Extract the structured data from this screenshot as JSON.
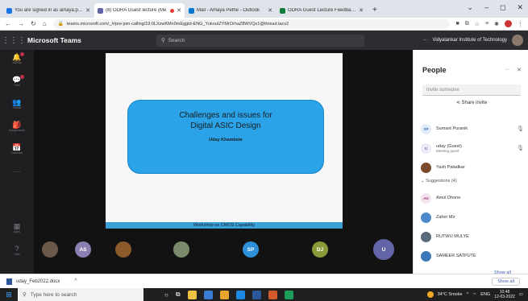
{
  "browser": {
    "tabs": [
      {
        "title": "You are signed in as amaya.pethe",
        "favicon_color": "#1a73e8",
        "active": false,
        "recording": false
      },
      {
        "title": "(8) ODRA Guest lecture (Me",
        "favicon_color": "#6264a7",
        "active": true,
        "recording": true
      },
      {
        "title": "Mail - Amaya Pethe - Outlook",
        "favicon_color": "#0078d4",
        "active": false,
        "recording": false
      },
      {
        "title": "ODRA Guest Lecture Feedback i",
        "favicon_color": "#0f7b3b",
        "active": false,
        "recording": false
      }
    ],
    "new_tab": "+",
    "window_controls": [
      "⌄",
      "–",
      "◻",
      "✕"
    ],
    "url": "teams.microsoft.com/_#/pre-join-calling/19:0LXzwKMn9mEggtd-ENG_YukouIZYMrOrhaZ8WVQs1@thread.tacv2"
  },
  "teams": {
    "brand": "Microsoft Teams",
    "search_placeholder": "Search",
    "org_name": "Vidyalankar Institute of Technology",
    "more_glyph": "···"
  },
  "rail": [
    {
      "icon": "bell-icon",
      "glyph": "🔔",
      "label": "Activity",
      "badge": true
    },
    {
      "icon": "chat-icon",
      "glyph": "💬",
      "label": "Chat",
      "badge": true
    },
    {
      "icon": "teams-icon",
      "glyph": "👥",
      "label": "Teams",
      "badge": false
    },
    {
      "icon": "assignments-icon",
      "glyph": "🎒",
      "label": "Assignments",
      "badge": false
    },
    {
      "icon": "calendar-icon",
      "glyph": "📅",
      "label": "Calendar",
      "badge": false
    },
    {
      "icon": "more-icon",
      "glyph": "···",
      "label": "",
      "badge": false
    },
    {
      "icon": "apps-icon",
      "glyph": "▦",
      "label": "Apps",
      "badge": false
    },
    {
      "icon": "help-icon",
      "glyph": "?",
      "label": "Help",
      "badge": false
    }
  ],
  "slide": {
    "title_line1": "Challenges  and issues for",
    "title_line2": "Digital ASIC Design",
    "author": "Uday Khambete",
    "caption": "Workshop on CMOS Capability",
    "box_color": "#2aa3e8"
  },
  "participants_strip": [
    {
      "initials": "",
      "kind": "photo1"
    },
    {
      "initials": "AS",
      "color": "#8b7fb2"
    },
    {
      "initials": "",
      "kind": "photo2"
    },
    {
      "initials": "",
      "kind": "photo3"
    },
    {
      "initials": "SP",
      "color": "#2f8fd8"
    },
    {
      "initials": "DJ",
      "color": "#8a9a3a"
    },
    {
      "initials": "U",
      "kind": "self"
    }
  ],
  "people": {
    "title": "People",
    "invite_placeholder": "Invite someone",
    "share_invite": "Share invite",
    "list": [
      {
        "name": "Sumant Puranik",
        "sub": "",
        "initials": "SP",
        "bg": "#e3ecf9",
        "fg": "#2f6fb8"
      },
      {
        "name": "uday (Guest)",
        "sub": "Meeting guest",
        "initials": "U",
        "bg": "#ebeaf6",
        "fg": "#6264a7"
      },
      {
        "name": "Yash Patadkar",
        "sub": "",
        "initials": "",
        "bg": "#7a4a2a",
        "fg": "#ffffff"
      }
    ],
    "suggestions_title": "Suggestions (4)",
    "suggestions": [
      {
        "name": "Amol Dhone",
        "initials": "AD",
        "bg": "#f3e3ee",
        "fg": "#a23b7e"
      },
      {
        "name": "Zaher Mir",
        "initials": "",
        "bg": "#4a8ac8",
        "fg": "#ffffff"
      },
      {
        "name": "RUTWIJ MULYE",
        "initials": "",
        "bg": "#5a6a7a",
        "fg": "#ffffff"
      },
      {
        "name": "SAMEER SATPUTE",
        "initials": "",
        "bg": "#3a7ab8",
        "fg": "#ffffff"
      }
    ],
    "show_all": "Show all"
  },
  "download": {
    "filename": "uday_Feb2022.docx",
    "show_all": "Show all"
  },
  "taskbar": {
    "search_placeholder": "Type here to search",
    "weather": "34°C  Smoke",
    "lang": "ENG",
    "time": "10:48",
    "date": "12-03-2022",
    "apps": [
      "#f0c040",
      "#3a7bd5",
      "#e9a52b",
      "#1e88e5",
      "#2b579a",
      "#d35a2a",
      "#1a9e5a"
    ]
  }
}
